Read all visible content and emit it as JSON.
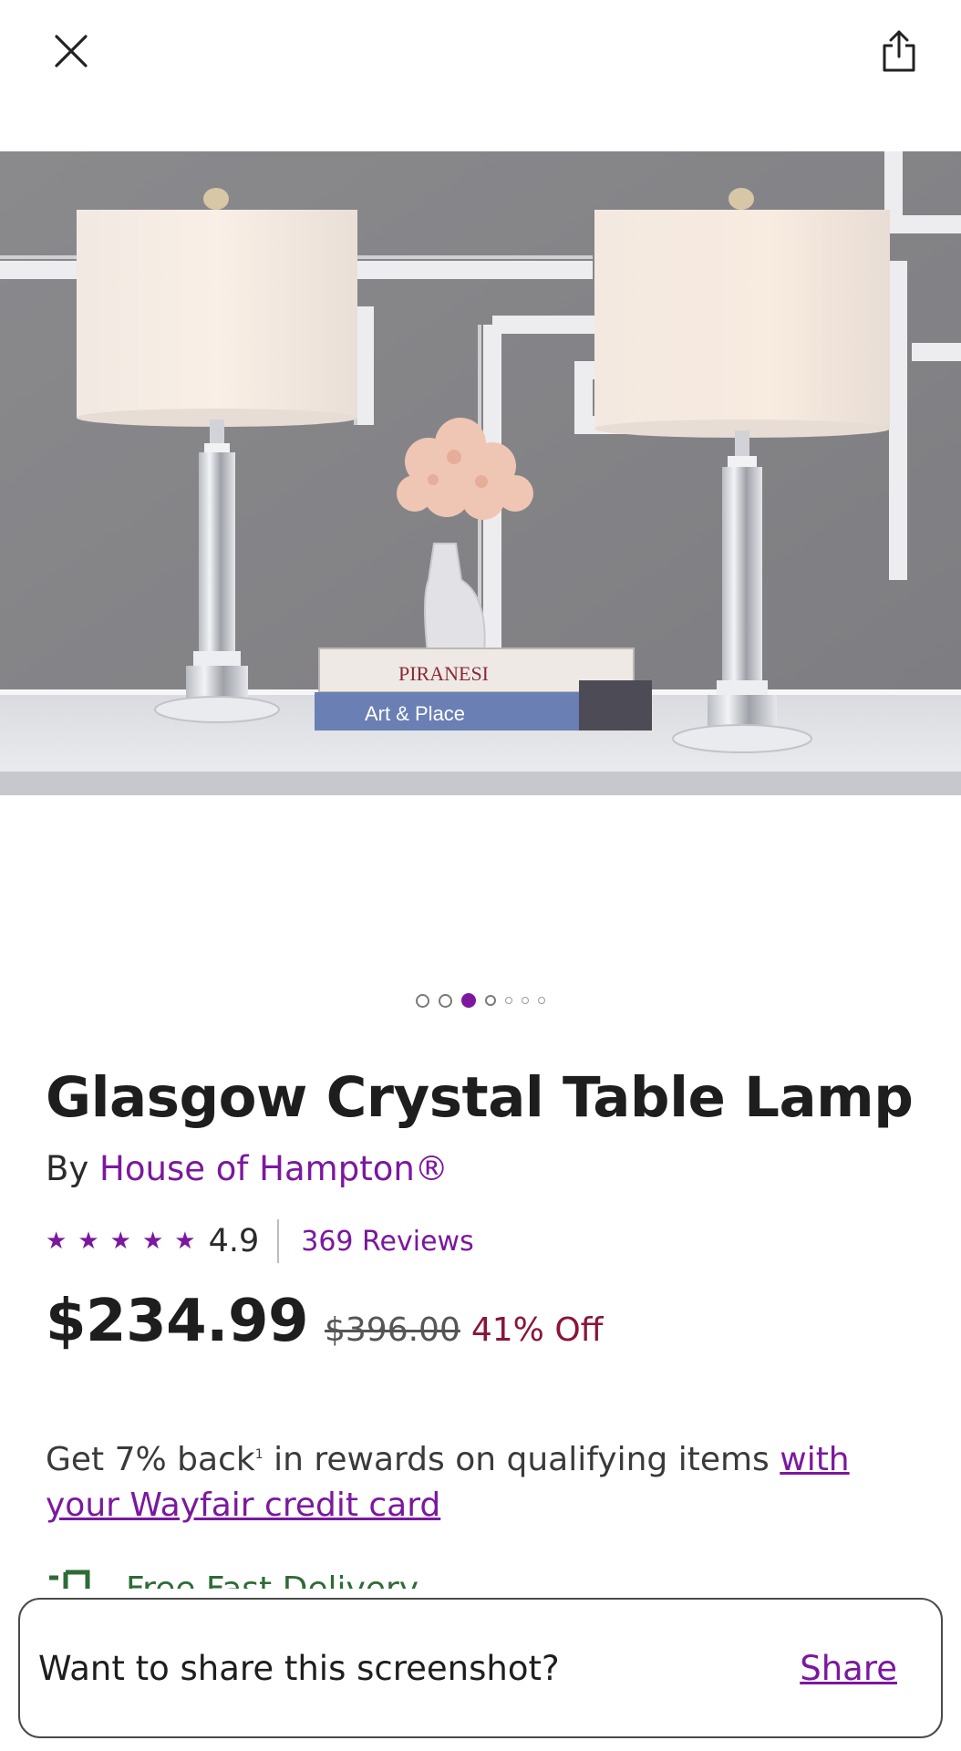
{
  "header": {
    "close_icon": "close-icon",
    "share_icon": "share-icon"
  },
  "gallery": {
    "image_label": "product-photo",
    "dot_count": 7,
    "active_index": 2,
    "book_top": "PIRANESI",
    "book_bottom": "Art & Place"
  },
  "product": {
    "title": "Glasgow Crystal Table Lamp",
    "by_label": "By",
    "brand": "House of Hampton®",
    "rating": "4.9",
    "rating_stars": 5,
    "reviews": "369 Reviews",
    "price": "$234.99",
    "old_price": "$396.00",
    "discount": "41% Off"
  },
  "rewards": {
    "text_1": "Get 7% back",
    "footnote": "1",
    "text_2": " in rewards on qualifying items ",
    "link": "with your Wayfair credit card"
  },
  "delivery": {
    "text": "Free Fast Delivery"
  },
  "toast": {
    "message": "Want to share this screenshot?",
    "action": "Share"
  },
  "colors": {
    "accent": "#7b189f",
    "discount": "#8a1538",
    "delivery": "#2e6b36"
  }
}
